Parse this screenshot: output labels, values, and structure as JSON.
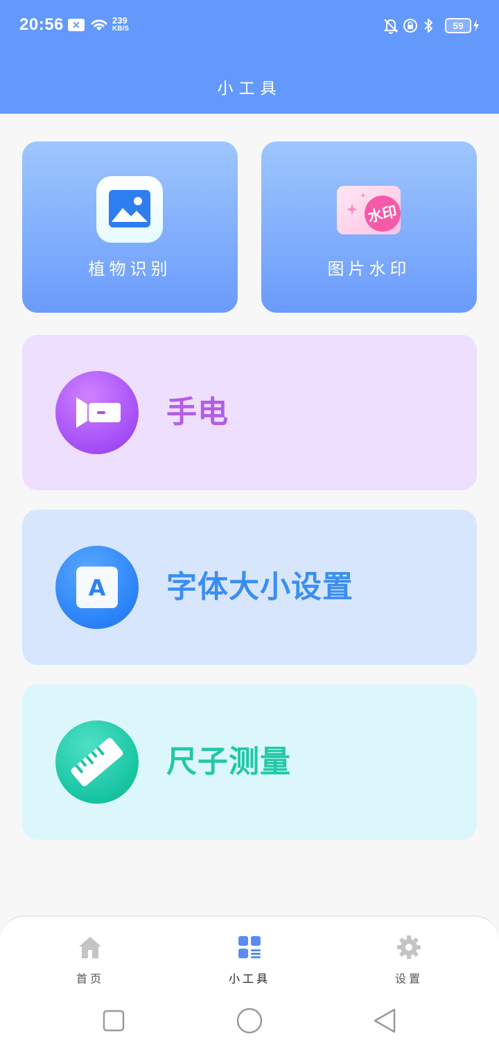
{
  "status_bar": {
    "time": "20:56",
    "notif_badge": "✕",
    "speed_value": "239",
    "speed_unit": "KB/S",
    "battery": "59"
  },
  "header": {
    "title": "小工具"
  },
  "tools": {
    "tiles": [
      {
        "label": "植物识别",
        "icon": "image-icon"
      },
      {
        "label": "图片水印",
        "icon": "watermark-icon",
        "badge": "水印"
      }
    ],
    "cards": [
      {
        "label": "手电",
        "icon": "flashlight-icon"
      },
      {
        "label": "字体大小设置",
        "icon": "font-size-icon",
        "glyph": "A"
      },
      {
        "label": "尺子测量",
        "icon": "ruler-icon"
      }
    ]
  },
  "bottom_nav": {
    "items": [
      {
        "label": "首页",
        "icon": "home-icon"
      },
      {
        "label": "小工具",
        "icon": "grid-icon",
        "active": true
      },
      {
        "label": "设置",
        "icon": "gear-icon"
      }
    ]
  },
  "colors": {
    "header": "#6499fc",
    "flash_card": "#eddffd",
    "font_card": "#d8e6fd",
    "ruler_card": "#dcf7fb",
    "active_nav": "#5b8cf3"
  }
}
